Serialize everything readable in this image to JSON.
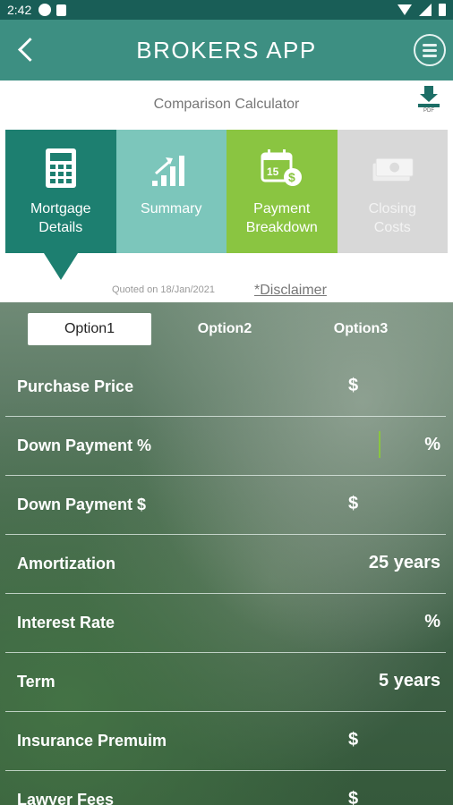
{
  "status_bar": {
    "time": "2:42"
  },
  "app_bar": {
    "title": "BROKERS APP"
  },
  "calculator": {
    "title": "Comparison Calculator",
    "pdf_label": "PDF"
  },
  "tabs": [
    {
      "label_line1": "Mortgage",
      "label_line2": "Details",
      "icon": "calculator-icon"
    },
    {
      "label_line1": "Summary",
      "label_line2": "",
      "icon": "bar-chart-icon"
    },
    {
      "label_line1": "Payment",
      "label_line2": "Breakdown",
      "icon": "calendar-money-icon"
    },
    {
      "label_line1": "Closing",
      "label_line2": "Costs",
      "icon": "cash-icon"
    }
  ],
  "quoted_text": "Quoted on 18/Jan/2021",
  "disclaimer": "*Disclaimer",
  "options": [
    "Option1",
    "Option2",
    "Option3"
  ],
  "rows": [
    {
      "label": "Purchase Price",
      "prefix": "$"
    },
    {
      "label": "Down Payment %",
      "suffix": "%"
    },
    {
      "label": "Down Payment $",
      "prefix": "$"
    },
    {
      "label": "Amortization",
      "value": "25 years"
    },
    {
      "label": "Interest Rate",
      "suffix": "%"
    },
    {
      "label": "Term",
      "value": "5 years"
    },
    {
      "label": "Insurance Premuim",
      "prefix": "$"
    },
    {
      "label": "Lawyer Fees",
      "prefix": "$"
    }
  ],
  "colors": {
    "status_bar": "#195e57",
    "app_bar": "#3d8f82",
    "tab_mortgage": "#1d7f70",
    "tab_summary": "#7cc6bb",
    "tab_payment": "#8ac541",
    "tab_closing": "#d8d8d8"
  }
}
